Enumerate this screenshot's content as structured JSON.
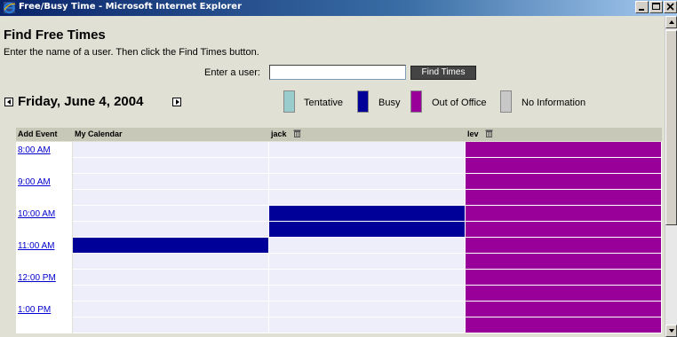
{
  "window": {
    "title": "Free/Busy Time - Microsoft Internet Explorer",
    "icon": "ie-icon",
    "controls": [
      "minimize-icon",
      "maximize-icon",
      "close-icon"
    ]
  },
  "page": {
    "title": "Find Free Times",
    "instructions": "Enter the name of a user. Then click the Find Times button.",
    "user_label": "Enter a user:",
    "user_value": "",
    "find_button": "Find Times",
    "date": "Friday, June 4, 2004"
  },
  "legend": [
    {
      "label": "Tentative",
      "color": "#99cccc"
    },
    {
      "label": "Busy",
      "color": "#000099"
    },
    {
      "label": "Out of Office",
      "color": "#990099"
    },
    {
      "label": "No Information",
      "color": "#c8c8c8"
    }
  ],
  "grid": {
    "headers": {
      "add_event": "Add Event",
      "my_calendar": "My Calendar",
      "user1": "jack",
      "user2": "lev"
    },
    "times": [
      "8:00 AM",
      "9:00 AM",
      "10:00 AM",
      "11:00 AM",
      "12:00 PM",
      "1:00 PM"
    ],
    "status_colors": {
      "free": "#eeeefa",
      "busy": "#000099",
      "oof": "#990099"
    },
    "rows": [
      {
        "my": "free",
        "jack": "free",
        "lev": "oof"
      },
      {
        "my": "free",
        "jack": "free",
        "lev": "oof"
      },
      {
        "my": "free",
        "jack": "free",
        "lev": "oof"
      },
      {
        "my": "free",
        "jack": "free",
        "lev": "oof"
      },
      {
        "my": "free",
        "jack": "busy",
        "lev": "oof"
      },
      {
        "my": "free",
        "jack": "busy",
        "lev": "oof"
      },
      {
        "my": "busy",
        "jack": "free",
        "lev": "oof"
      },
      {
        "my": "free",
        "jack": "free",
        "lev": "oof"
      },
      {
        "my": "free",
        "jack": "free",
        "lev": "oof"
      },
      {
        "my": "free",
        "jack": "free",
        "lev": "oof"
      },
      {
        "my": "free",
        "jack": "free",
        "lev": "oof"
      },
      {
        "my": "free",
        "jack": "free",
        "lev": "oof"
      }
    ]
  }
}
